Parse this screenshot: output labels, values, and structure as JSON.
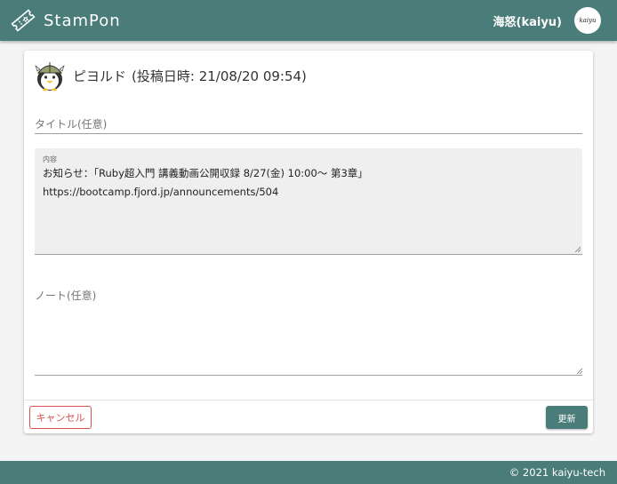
{
  "header": {
    "brand": "StamPon",
    "username": "海怒(kaiyu)",
    "avatar_text": "kaiyu",
    "accent_color": "#4a7d79"
  },
  "post": {
    "author": "ピヨルド",
    "meta": "(投稿日時: 21/08/20 09:54)"
  },
  "form": {
    "title_placeholder": "タイトル(任意)",
    "title_value": "",
    "content_label": "内容",
    "content_value": "お知らせ：「Ruby超入門 講義動画公開収録 8/27(金) 10:00～ 第3章」\nhttps://bootcamp.fjord.jp/announcements/504",
    "note_placeholder": "ノート(任意)",
    "note_value": ""
  },
  "actions": {
    "cancel_label": "キャンセル",
    "update_label": "更新",
    "cancel_color": "#d9534f"
  },
  "footer": {
    "copyright": "© 2021 kaiyu-tech"
  },
  "icons": {
    "logo": "ticket-icon",
    "post_avatar": "penguin-viking-icon"
  }
}
